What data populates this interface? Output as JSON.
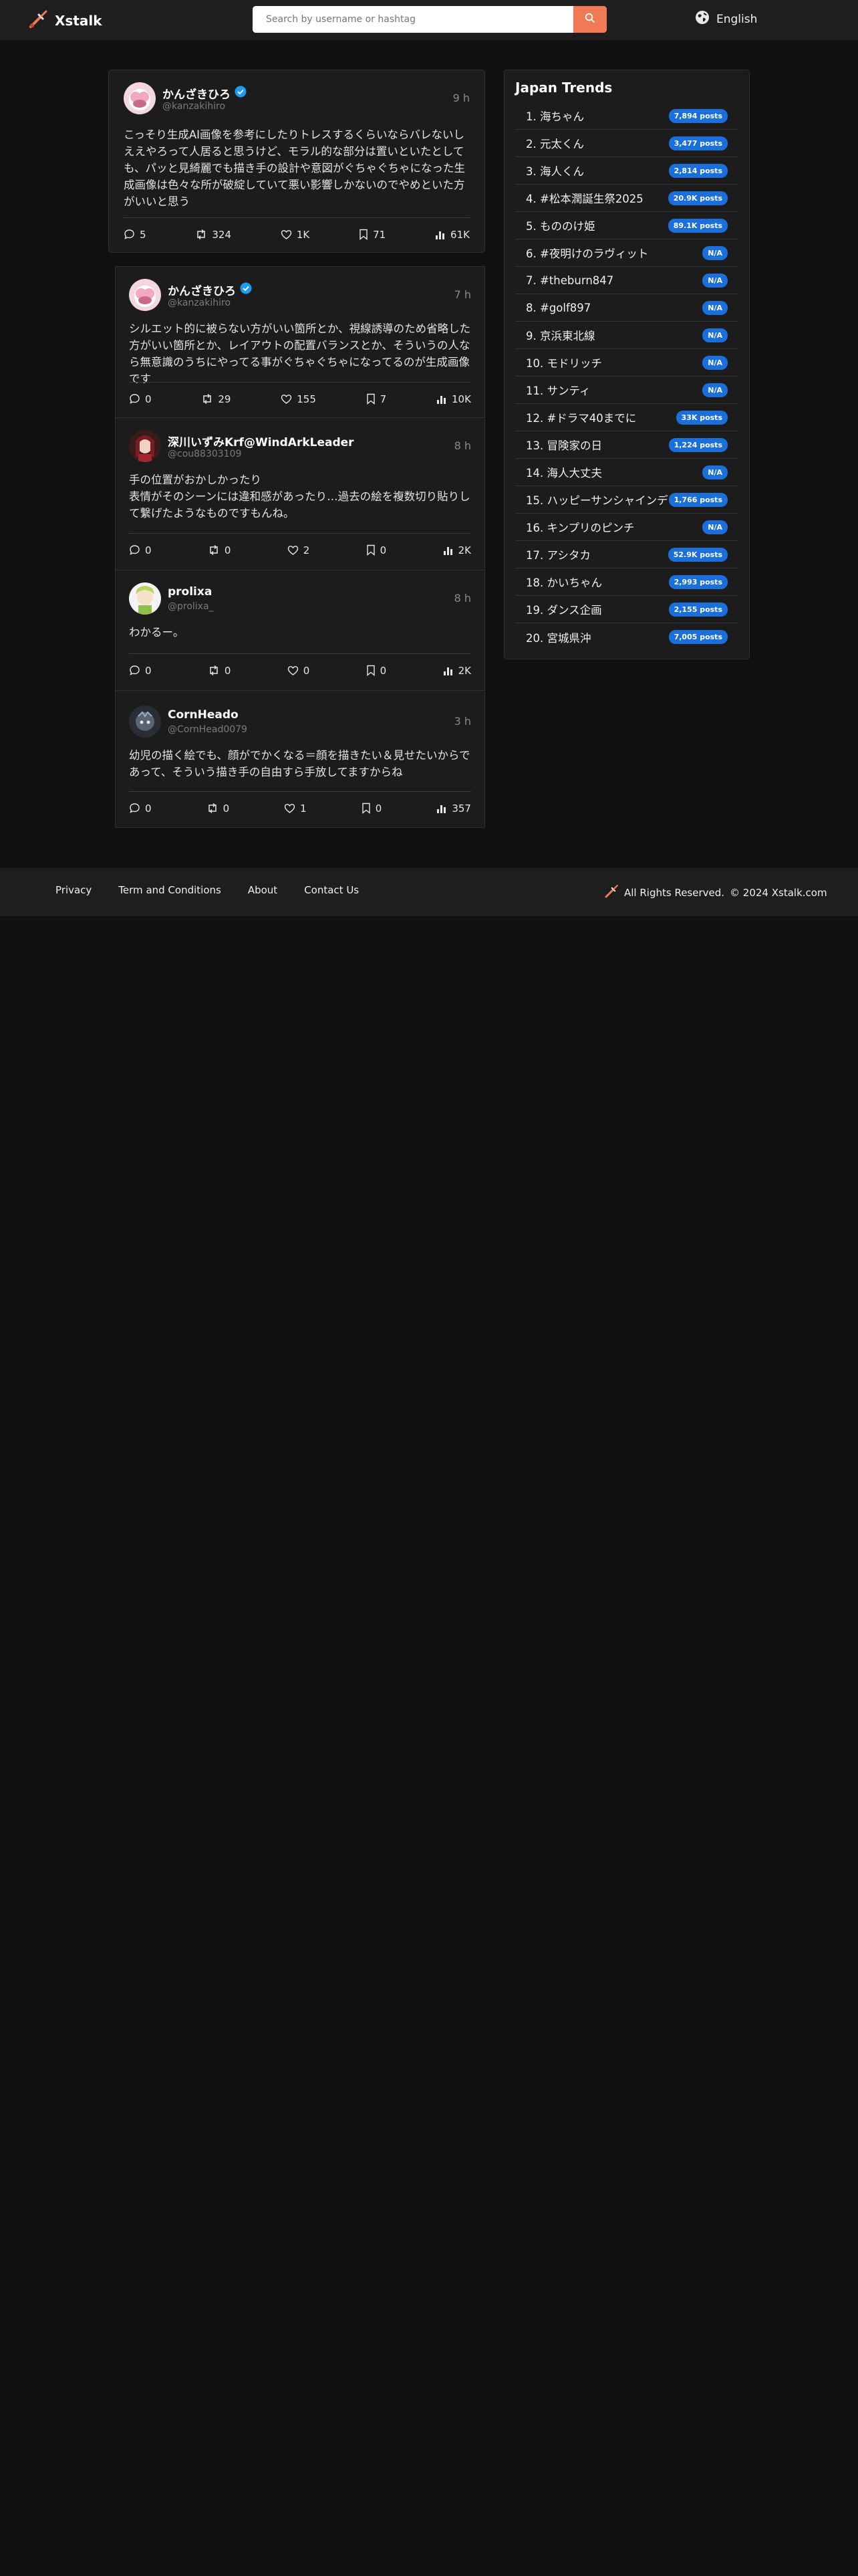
{
  "header": {
    "brand": "Xstalk",
    "search_placeholder": "Search by username or hashtag",
    "language": "English"
  },
  "main_post": {
    "name": "かんざきひろ",
    "verified": true,
    "handle": "@kanzakihiro",
    "time": "9 h",
    "text": "こっそり生成AI画像を参考にしたりトレスするくらいならバレないしええやろって人居ると思うけど、モラル的な部分は置いといたとしても、パッと見綺麗でも描き手の設計や意図がぐちゃぐちゃになった生成画像は色々な所が破綻していて悪い影響しかないのでやめといた方がいいと思う",
    "replies": "5",
    "retweets": "324",
    "likes": "1K",
    "bookmarks": "71",
    "views": "61K"
  },
  "replies": [
    {
      "name": "かんざきひろ",
      "verified": true,
      "handle": "@kanzakihiro",
      "time": "7 h",
      "text": "シルエット的に被らない方がいい箇所とか、視線誘導のため省略した方がいい箇所とか、レイアウトの配置バランスとか、そういうの人なら無意識のうちにやってる事がぐちゃぐちゃになってるのが生成画像です",
      "replies": "0",
      "retweets": "29",
      "likes": "155",
      "bookmarks": "7",
      "views": "10K"
    },
    {
      "name": "深川いずみKrf@WindArkLeader",
      "verified": false,
      "handle": "@cou88303109",
      "time": "8 h",
      "text": "手の位置がおかしかったり\n表情がそのシーンには違和感があったり…過去の絵を複数切り貼りして繋げたようなものですもんね。",
      "replies": "0",
      "retweets": "0",
      "likes": "2",
      "bookmarks": "0",
      "views": "2K"
    },
    {
      "name": "prolixa",
      "verified": false,
      "handle": "@prolixa_",
      "time": "8 h",
      "text": "わかるー。",
      "replies": "0",
      "retweets": "0",
      "likes": "0",
      "bookmarks": "0",
      "views": "2K"
    },
    {
      "name": "CornHeado",
      "verified": false,
      "handle": "@CornHead0079",
      "time": "3 h",
      "text": "幼児の描く絵でも、顔がでかくなる＝顔を描きたい＆見せたいからであって、そういう描き手の自由すら手放してますからね",
      "replies": "0",
      "retweets": "0",
      "likes": "1",
      "bookmarks": "0",
      "views": "357"
    }
  ],
  "trends": {
    "title": "Japan Trends",
    "items": [
      {
        "label": "1. 海ちゃん",
        "count": "7,894 posts"
      },
      {
        "label": "2. 元太くん",
        "count": "3,477 posts"
      },
      {
        "label": "3. 海人くん",
        "count": "2,814 posts"
      },
      {
        "label": "4. #松本潤誕生祭2025",
        "count": "20.9K posts"
      },
      {
        "label": "5. もののけ姫",
        "count": "89.1K posts"
      },
      {
        "label": "6. #夜明けのラヴィット",
        "count": "N/A"
      },
      {
        "label": "7. #theburn847",
        "count": "N/A"
      },
      {
        "label": "8. #golf897",
        "count": "N/A"
      },
      {
        "label": "9. 京浜東北線",
        "count": "N/A"
      },
      {
        "label": "10. モドリッチ",
        "count": "N/A"
      },
      {
        "label": "11. サンティ",
        "count": "N/A"
      },
      {
        "label": "12. #ドラマ40までに",
        "count": "33K posts"
      },
      {
        "label": "13. 冒険家の日",
        "count": "1,224 posts"
      },
      {
        "label": "14. 海人大丈夫",
        "count": "N/A"
      },
      {
        "label": "15. ハッピーサンシャインデー",
        "count": "1,766 posts"
      },
      {
        "label": "16. キンプリのピンチ",
        "count": "N/A"
      },
      {
        "label": "17. アシタカ",
        "count": "52.9K posts"
      },
      {
        "label": "18. かいちゃん",
        "count": "2,993 posts"
      },
      {
        "label": "19. ダンス企画",
        "count": "2,155 posts"
      },
      {
        "label": "20. 宮城県沖",
        "count": "7,005 posts"
      }
    ]
  },
  "footer": {
    "links": [
      "Privacy",
      "Term and Conditions",
      "About",
      "Contact Us"
    ],
    "rights": "All Rights Reserved.",
    "copyright": "© 2024 Xstalk.com"
  },
  "colors": {
    "accent": "#f07a55",
    "badge": "#1a6fdb",
    "verified": "#1d9bf0"
  }
}
